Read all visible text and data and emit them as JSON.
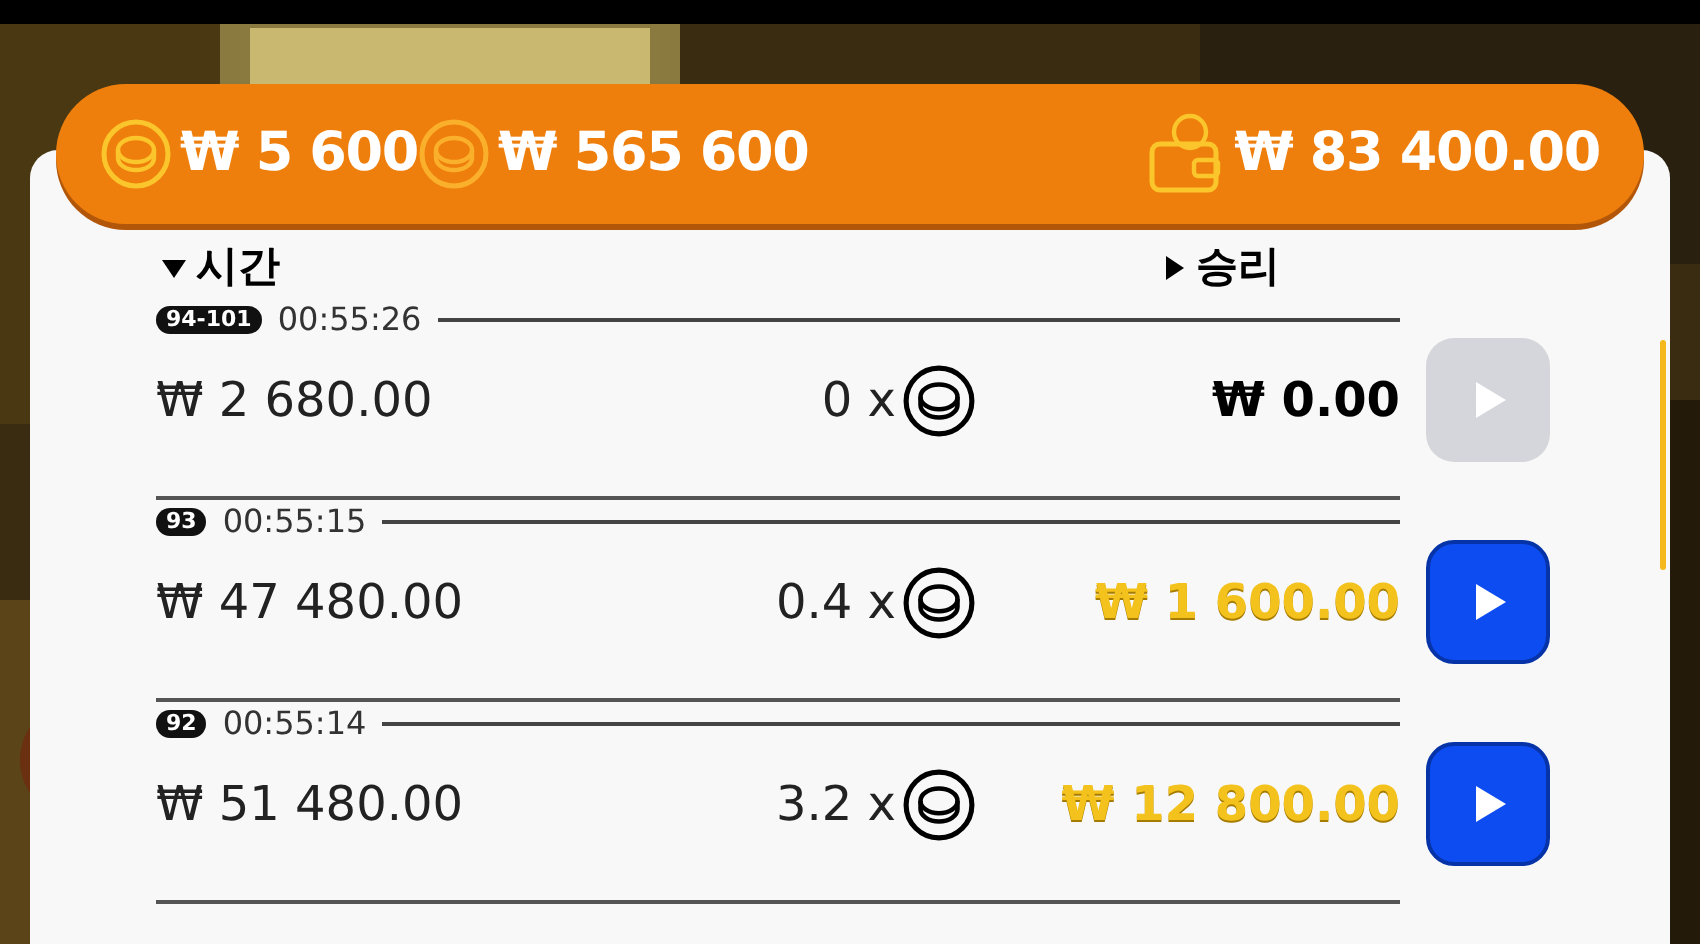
{
  "balance_bar": {
    "bet_amount": "₩ 5 600",
    "total_amount": "₩ 565 600",
    "wallet_amount": "₩ 83 400.00"
  },
  "columns": [
    {
      "label": "시간",
      "expanded": true
    },
    {
      "label": "승리",
      "expanded": false
    }
  ],
  "rows": [
    {
      "round": "94-101",
      "time": "00:55:26",
      "bet": "₩ 2 680.00",
      "multiplier": "0 x",
      "win": "₩ 0.00",
      "won": false,
      "replay_disabled": true
    },
    {
      "round": "93",
      "time": "00:55:15",
      "bet": "₩ 47 480.00",
      "multiplier": "0.4 x",
      "win": "₩ 1 600.00",
      "won": true,
      "replay_disabled": false
    },
    {
      "round": "92",
      "time": "00:55:14",
      "bet": "₩ 51 480.00",
      "multiplier": "3.2 x",
      "win": "₩ 12 800.00",
      "won": true,
      "replay_disabled": false
    }
  ]
}
